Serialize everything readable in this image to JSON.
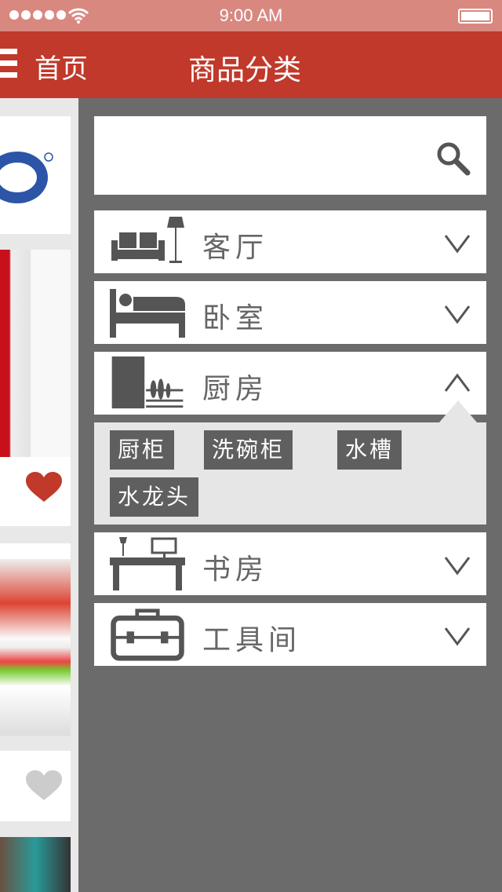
{
  "status": {
    "time": "9:00 AM"
  },
  "nav": {
    "home": "首页",
    "title": "商品分类"
  },
  "categories": [
    {
      "label": "客厅",
      "icon": "sofa-lamp-icon",
      "expanded": false
    },
    {
      "label": "卧室",
      "icon": "bed-icon",
      "expanded": false
    },
    {
      "label": "厨房",
      "icon": "kitchen-icon",
      "expanded": true,
      "sub": [
        "厨柜",
        "洗碗柜",
        "水槽",
        "水龙头"
      ]
    },
    {
      "label": "书房",
      "icon": "desk-icon",
      "expanded": false
    },
    {
      "label": "工具间",
      "icon": "toolbox-icon",
      "expanded": false
    }
  ],
  "colors": {
    "brand": "#c0392b",
    "panel": "#6b6b6b",
    "icon": "#555555"
  }
}
